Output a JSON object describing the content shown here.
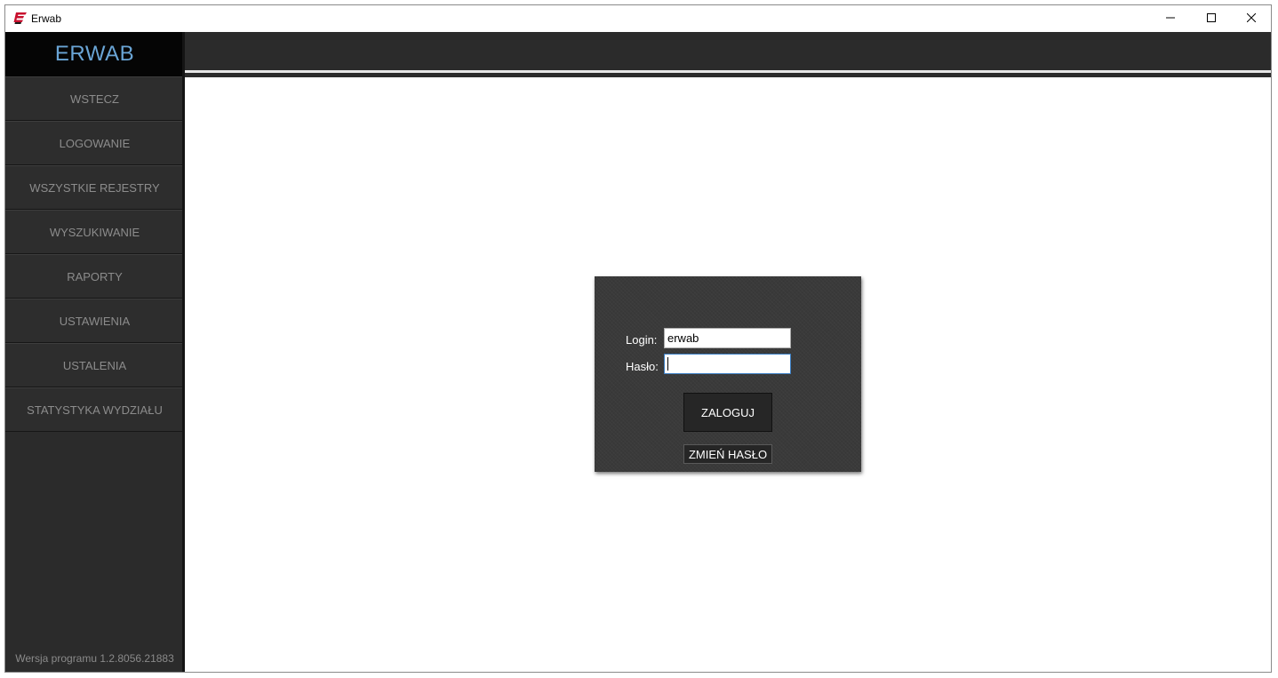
{
  "window": {
    "title": "Erwab",
    "icon": "erwab-app-icon",
    "controls": [
      "minimize-icon",
      "maximize-icon",
      "close-icon"
    ]
  },
  "sidebar": {
    "brand": "ERWAB",
    "items": [
      {
        "label": "WSTECZ"
      },
      {
        "label": "LOGOWANIE"
      },
      {
        "label": "WSZYSTKIE REJESTRY"
      },
      {
        "label": "WYSZUKIWANIE"
      },
      {
        "label": "RAPORTY"
      },
      {
        "label": "USTAWIENIA"
      },
      {
        "label": "USTALENIA"
      },
      {
        "label": "STATYSTYKA WYDZIAŁU"
      }
    ],
    "version": "Wersja programu 1.2.8056.21883"
  },
  "login": {
    "login_label": "Login:",
    "login_value": "erwab",
    "password_label": "Hasło:",
    "password_value": "",
    "submit_label": "ZALOGUJ",
    "change_password_label": "ZMIEŃ HASŁO"
  },
  "colors": {
    "sidebar_bg": "#2b2b2b",
    "brand_bg": "#050505",
    "brand_text": "#6aa5d6",
    "nav_text": "#8c8c8c",
    "panel_bg": "#3a3a3a",
    "focus_border": "#3c7fc4"
  }
}
